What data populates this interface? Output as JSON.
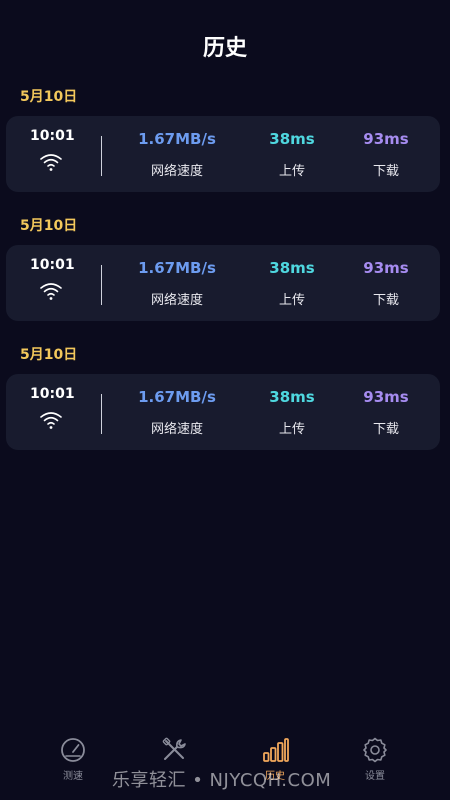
{
  "header": {
    "title": "历史"
  },
  "records": [
    {
      "date": "5月10日",
      "time": "10:01",
      "speed": "1.67MB/s",
      "speed_label": "网络速度",
      "upload": "38ms",
      "upload_label": "上传",
      "download": "93ms",
      "download_label": "下载"
    },
    {
      "date": "5月10日",
      "time": "10:01",
      "speed": "1.67MB/s",
      "speed_label": "网络速度",
      "upload": "38ms",
      "upload_label": "上传",
      "download": "93ms",
      "download_label": "下载"
    },
    {
      "date": "5月10日",
      "time": "10:01",
      "speed": "1.67MB/s",
      "speed_label": "网络速度",
      "upload": "38ms",
      "upload_label": "上传",
      "download": "93ms",
      "download_label": "下载"
    }
  ],
  "tabs": [
    {
      "label": "测速",
      "icon": "speedometer-icon"
    },
    {
      "label": "",
      "icon": "tools-icon"
    },
    {
      "label": "历史",
      "icon": "bar-chart-icon",
      "active": true
    },
    {
      "label": "设置",
      "icon": "gear-icon"
    }
  ],
  "watermark": "乐享轻汇 • NJYCQH.COM",
  "colors": {
    "background": "#0b0b1d",
    "card": "#181b2e",
    "date": "#f3c85c",
    "speed": "#6d9cf0",
    "upload": "#4fd8e0",
    "download": "#a68cf0",
    "active_tab": "#f3a95c"
  }
}
